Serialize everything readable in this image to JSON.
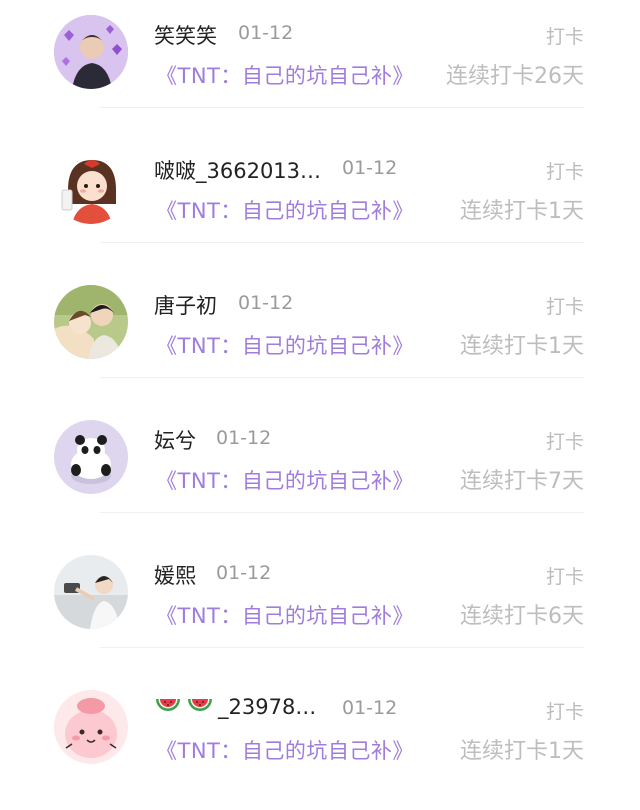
{
  "entries": [
    {
      "name": "笑笑笑",
      "date": "01-12",
      "action": "打卡",
      "topic": "《TNT：自己的坑自己补》",
      "streak": "连续打卡26天",
      "avatar_icon": "purple-hearts-portrait-avatar"
    },
    {
      "name": "啵啵_3662013…",
      "date": "01-12",
      "action": "打卡",
      "topic": "《TNT：自己的坑自己补》",
      "streak": "连续打卡1天",
      "avatar_icon": "cartoon-girl-avatar"
    },
    {
      "name": "唐子初",
      "date": "01-12",
      "action": "打卡",
      "topic": "《TNT：自己的坑自己补》",
      "streak": "连续打卡1天",
      "avatar_icon": "illustrated-couple-avatar"
    },
    {
      "name": "妘兮",
      "date": "01-12",
      "action": "打卡",
      "topic": "《TNT：自己的坑自己补》",
      "streak": "连续打卡7天",
      "avatar_icon": "panda-avatar"
    },
    {
      "name": "媛熙",
      "date": "01-12",
      "action": "打卡",
      "topic": "《TNT：自己的坑自己补》",
      "streak": "连续打卡6天",
      "avatar_icon": "photo-person-avatar"
    },
    {
      "name": "_23978…",
      "name_prefix_icons": [
        "watermelon-icon",
        "watermelon-icon"
      ],
      "date": "01-12",
      "action": "打卡",
      "topic": "《TNT：自己的坑自己补》",
      "streak": "连续打卡1天",
      "avatar_icon": "pink-blob-avatar"
    }
  ],
  "colors": {
    "topic": "#a07cdc",
    "name": "#222222",
    "muted": "#bdbdbd"
  }
}
